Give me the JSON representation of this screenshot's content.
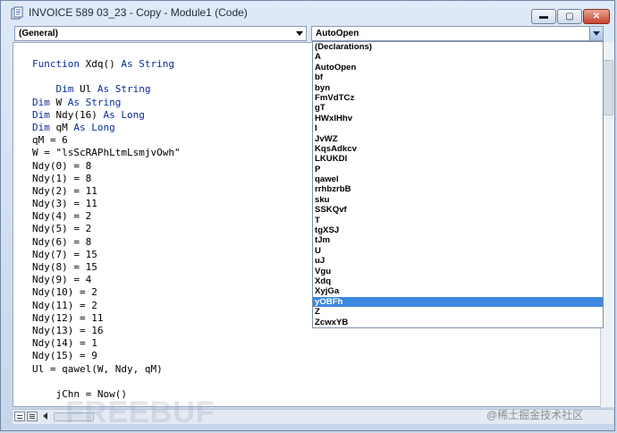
{
  "window": {
    "title": "INVOICE 589 03_23 - Copy - Module1 (Code)",
    "minimize_glyph": "▬",
    "maximize_glyph": "▢",
    "close_glyph": "✕"
  },
  "object_combo": {
    "value": "(General)"
  },
  "procedure_combo": {
    "value": "AutoOpen"
  },
  "procedure_list": {
    "items": [
      "(Declarations)",
      "A",
      "AutoOpen",
      "bf",
      "byn",
      "FmVdTCz",
      "gT",
      "HWxlHhv",
      "I",
      "JvWZ",
      "KqsAdkcv",
      "LKUKDI",
      "P",
      "qawel",
      "rrhbzrbB",
      "sku",
      "SSKQvf",
      "T",
      "tgXSJ",
      "tJm",
      "U",
      "uJ",
      "Vgu",
      "Xdq",
      "XyjGa",
      "yOBFh",
      "Z",
      "ZcwxYB"
    ],
    "selected": "yOBFh"
  },
  "code_lines": [
    {
      "pre": "",
      "kw1": "Function",
      "mid": " Xdq() ",
      "kw2": "As String",
      "post": ""
    },
    {
      "pre": "",
      "kw1": "",
      "mid": "",
      "kw2": "",
      "post": ""
    },
    {
      "pre": "    ",
      "kw1": "Dim",
      "mid": " Ul ",
      "kw2": "As String",
      "post": ""
    },
    {
      "pre": "",
      "kw1": "Dim",
      "mid": " W ",
      "kw2": "As String",
      "post": ""
    },
    {
      "pre": "",
      "kw1": "Dim",
      "mid": " Ndy(16) ",
      "kw2": "As Long",
      "post": ""
    },
    {
      "pre": "",
      "kw1": "Dim",
      "mid": " qM ",
      "kw2": "As Long",
      "post": ""
    },
    {
      "pre": "",
      "kw1": "",
      "mid": "",
      "kw2": "",
      "post": "qM = 6"
    },
    {
      "pre": "",
      "kw1": "",
      "mid": "",
      "kw2": "",
      "post": "W = \"lsScRAPhLtmLsmjvOwh\""
    },
    {
      "pre": "",
      "kw1": "",
      "mid": "",
      "kw2": "",
      "post": "Ndy(0) = 8"
    },
    {
      "pre": "",
      "kw1": "",
      "mid": "",
      "kw2": "",
      "post": "Ndy(1) = 8"
    },
    {
      "pre": "",
      "kw1": "",
      "mid": "",
      "kw2": "",
      "post": "Ndy(2) = 11"
    },
    {
      "pre": "",
      "kw1": "",
      "mid": "",
      "kw2": "",
      "post": "Ndy(3) = 11"
    },
    {
      "pre": "",
      "kw1": "",
      "mid": "",
      "kw2": "",
      "post": "Ndy(4) = 2"
    },
    {
      "pre": "",
      "kw1": "",
      "mid": "",
      "kw2": "",
      "post": "Ndy(5) = 2"
    },
    {
      "pre": "",
      "kw1": "",
      "mid": "",
      "kw2": "",
      "post": "Ndy(6) = 8"
    },
    {
      "pre": "",
      "kw1": "",
      "mid": "",
      "kw2": "",
      "post": "Ndy(7) = 15"
    },
    {
      "pre": "",
      "kw1": "",
      "mid": "",
      "kw2": "",
      "post": "Ndy(8) = 15"
    },
    {
      "pre": "",
      "kw1": "",
      "mid": "",
      "kw2": "",
      "post": "Ndy(9) = 4"
    },
    {
      "pre": "",
      "kw1": "",
      "mid": "",
      "kw2": "",
      "post": "Ndy(10) = 2"
    },
    {
      "pre": "",
      "kw1": "",
      "mid": "",
      "kw2": "",
      "post": "Ndy(11) = 2"
    },
    {
      "pre": "",
      "kw1": "",
      "mid": "",
      "kw2": "",
      "post": "Ndy(12) = 11"
    },
    {
      "pre": "",
      "kw1": "",
      "mid": "",
      "kw2": "",
      "post": "Ndy(13) = 16"
    },
    {
      "pre": "",
      "kw1": "",
      "mid": "",
      "kw2": "",
      "post": "Ndy(14) = 1"
    },
    {
      "pre": "",
      "kw1": "",
      "mid": "",
      "kw2": "",
      "post": "Ndy(15) = 9"
    },
    {
      "pre": "",
      "kw1": "",
      "mid": "",
      "kw2": "",
      "post": "Ul = qawel(W, Ndy, qM)"
    },
    {
      "pre": "",
      "kw1": "",
      "mid": "",
      "kw2": "",
      "post": ""
    },
    {
      "pre": "",
      "kw1": "",
      "mid": "",
      "kw2": "",
      "post": "    jChn = Now()"
    }
  ],
  "watermark": {
    "text": "@稀土掘金技术社区",
    "logo": "FREEBUF"
  },
  "colors": {
    "keyword": "#0a2c9b",
    "selection": "#3d88de"
  }
}
